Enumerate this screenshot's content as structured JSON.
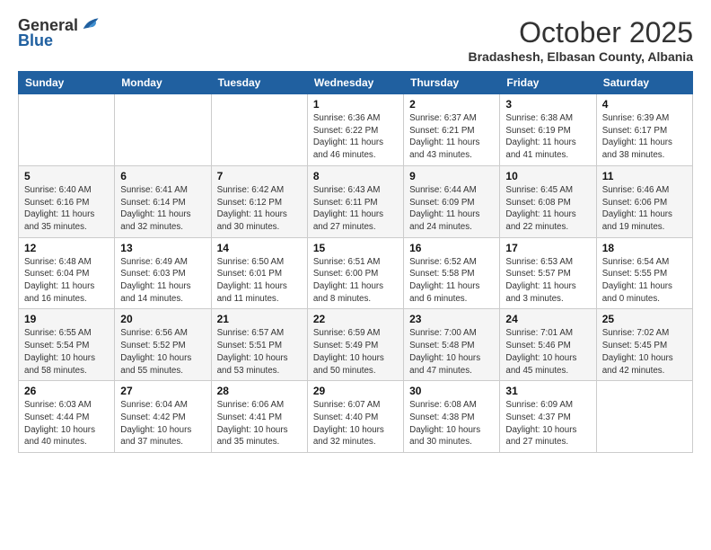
{
  "header": {
    "logo": {
      "line1": "General",
      "line2": "Blue"
    },
    "title": "October 2025",
    "subtitle": "Bradashesh, Elbasan County, Albania"
  },
  "days_of_week": [
    "Sunday",
    "Monday",
    "Tuesday",
    "Wednesday",
    "Thursday",
    "Friday",
    "Saturday"
  ],
  "weeks": [
    [
      {
        "day": "",
        "info": ""
      },
      {
        "day": "",
        "info": ""
      },
      {
        "day": "",
        "info": ""
      },
      {
        "day": "1",
        "info": "Sunrise: 6:36 AM\nSunset: 6:22 PM\nDaylight: 11 hours\nand 46 minutes."
      },
      {
        "day": "2",
        "info": "Sunrise: 6:37 AM\nSunset: 6:21 PM\nDaylight: 11 hours\nand 43 minutes."
      },
      {
        "day": "3",
        "info": "Sunrise: 6:38 AM\nSunset: 6:19 PM\nDaylight: 11 hours\nand 41 minutes."
      },
      {
        "day": "4",
        "info": "Sunrise: 6:39 AM\nSunset: 6:17 PM\nDaylight: 11 hours\nand 38 minutes."
      }
    ],
    [
      {
        "day": "5",
        "info": "Sunrise: 6:40 AM\nSunset: 6:16 PM\nDaylight: 11 hours\nand 35 minutes."
      },
      {
        "day": "6",
        "info": "Sunrise: 6:41 AM\nSunset: 6:14 PM\nDaylight: 11 hours\nand 32 minutes."
      },
      {
        "day": "7",
        "info": "Sunrise: 6:42 AM\nSunset: 6:12 PM\nDaylight: 11 hours\nand 30 minutes."
      },
      {
        "day": "8",
        "info": "Sunrise: 6:43 AM\nSunset: 6:11 PM\nDaylight: 11 hours\nand 27 minutes."
      },
      {
        "day": "9",
        "info": "Sunrise: 6:44 AM\nSunset: 6:09 PM\nDaylight: 11 hours\nand 24 minutes."
      },
      {
        "day": "10",
        "info": "Sunrise: 6:45 AM\nSunset: 6:08 PM\nDaylight: 11 hours\nand 22 minutes."
      },
      {
        "day": "11",
        "info": "Sunrise: 6:46 AM\nSunset: 6:06 PM\nDaylight: 11 hours\nand 19 minutes."
      }
    ],
    [
      {
        "day": "12",
        "info": "Sunrise: 6:48 AM\nSunset: 6:04 PM\nDaylight: 11 hours\nand 16 minutes."
      },
      {
        "day": "13",
        "info": "Sunrise: 6:49 AM\nSunset: 6:03 PM\nDaylight: 11 hours\nand 14 minutes."
      },
      {
        "day": "14",
        "info": "Sunrise: 6:50 AM\nSunset: 6:01 PM\nDaylight: 11 hours\nand 11 minutes."
      },
      {
        "day": "15",
        "info": "Sunrise: 6:51 AM\nSunset: 6:00 PM\nDaylight: 11 hours\nand 8 minutes."
      },
      {
        "day": "16",
        "info": "Sunrise: 6:52 AM\nSunset: 5:58 PM\nDaylight: 11 hours\nand 6 minutes."
      },
      {
        "day": "17",
        "info": "Sunrise: 6:53 AM\nSunset: 5:57 PM\nDaylight: 11 hours\nand 3 minutes."
      },
      {
        "day": "18",
        "info": "Sunrise: 6:54 AM\nSunset: 5:55 PM\nDaylight: 11 hours\nand 0 minutes."
      }
    ],
    [
      {
        "day": "19",
        "info": "Sunrise: 6:55 AM\nSunset: 5:54 PM\nDaylight: 10 hours\nand 58 minutes."
      },
      {
        "day": "20",
        "info": "Sunrise: 6:56 AM\nSunset: 5:52 PM\nDaylight: 10 hours\nand 55 minutes."
      },
      {
        "day": "21",
        "info": "Sunrise: 6:57 AM\nSunset: 5:51 PM\nDaylight: 10 hours\nand 53 minutes."
      },
      {
        "day": "22",
        "info": "Sunrise: 6:59 AM\nSunset: 5:49 PM\nDaylight: 10 hours\nand 50 minutes."
      },
      {
        "day": "23",
        "info": "Sunrise: 7:00 AM\nSunset: 5:48 PM\nDaylight: 10 hours\nand 47 minutes."
      },
      {
        "day": "24",
        "info": "Sunrise: 7:01 AM\nSunset: 5:46 PM\nDaylight: 10 hours\nand 45 minutes."
      },
      {
        "day": "25",
        "info": "Sunrise: 7:02 AM\nSunset: 5:45 PM\nDaylight: 10 hours\nand 42 minutes."
      }
    ],
    [
      {
        "day": "26",
        "info": "Sunrise: 6:03 AM\nSunset: 4:44 PM\nDaylight: 10 hours\nand 40 minutes."
      },
      {
        "day": "27",
        "info": "Sunrise: 6:04 AM\nSunset: 4:42 PM\nDaylight: 10 hours\nand 37 minutes."
      },
      {
        "day": "28",
        "info": "Sunrise: 6:06 AM\nSunset: 4:41 PM\nDaylight: 10 hours\nand 35 minutes."
      },
      {
        "day": "29",
        "info": "Sunrise: 6:07 AM\nSunset: 4:40 PM\nDaylight: 10 hours\nand 32 minutes."
      },
      {
        "day": "30",
        "info": "Sunrise: 6:08 AM\nSunset: 4:38 PM\nDaylight: 10 hours\nand 30 minutes."
      },
      {
        "day": "31",
        "info": "Sunrise: 6:09 AM\nSunset: 4:37 PM\nDaylight: 10 hours\nand 27 minutes."
      },
      {
        "day": "",
        "info": ""
      }
    ]
  ]
}
